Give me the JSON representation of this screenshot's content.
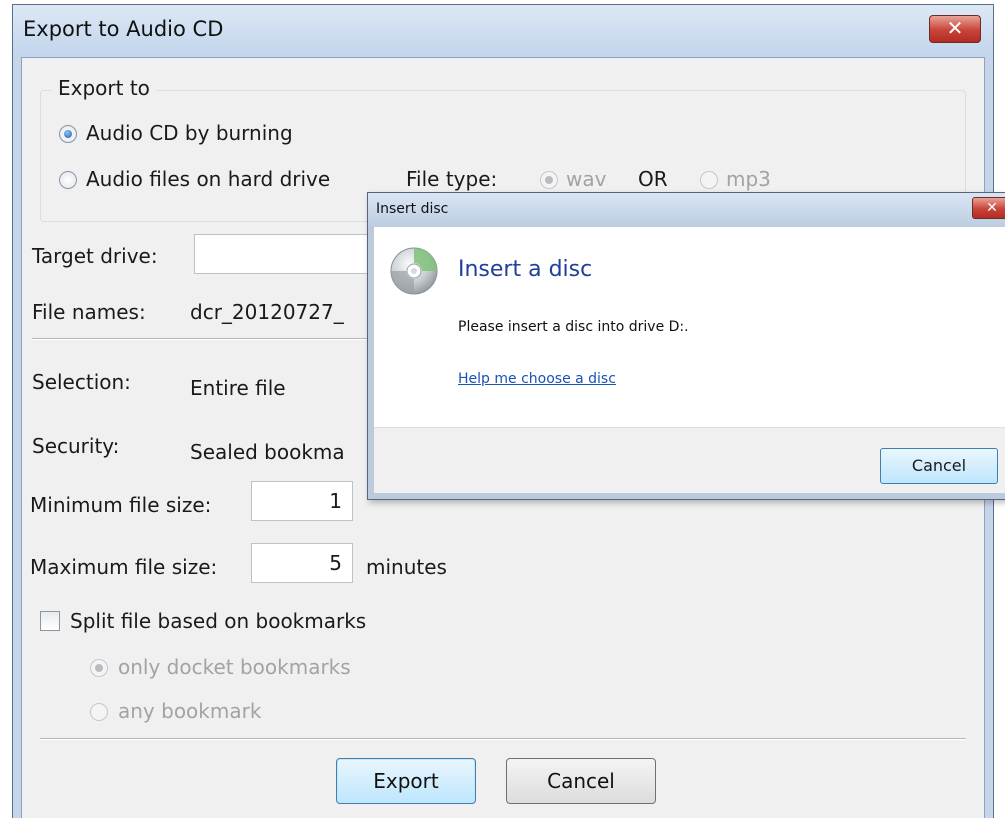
{
  "main_dialog": {
    "title": "Export to Audio CD",
    "close_glyph": "✕",
    "export_to": {
      "legend": "Export to",
      "option_burn": "Audio CD by burning",
      "option_files": "Audio files on hard drive",
      "file_type_label": "File type:",
      "type_wav": "wav",
      "or_label": "OR",
      "type_mp3": "mp3"
    },
    "target_drive_label": "Target drive:",
    "target_drive_value": "",
    "file_names_label": "File names:",
    "file_names_value": "dcr_20120727_",
    "selection_label": "Selection:",
    "selection_value": "Entire file",
    "security_label": "Security:",
    "security_value": "Sealed bookma",
    "min_size_label": "Minimum file size:",
    "min_size_value": "1",
    "max_size_label": "Maximum file size:",
    "max_size_value": "5",
    "max_size_unit": "minutes",
    "split_label": "Split file based on bookmarks",
    "split_checked": false,
    "split_option_docket": "only docket bookmarks",
    "split_option_any": "any bookmark",
    "export_button": "Export",
    "cancel_button": "Cancel"
  },
  "disc_dialog": {
    "title": "Insert disc",
    "close_glyph": "✕",
    "heading": "Insert a disc",
    "message": "Please insert a disc into drive D:.",
    "help_link": "Help me choose a disc",
    "cancel_button": "Cancel",
    "icon": "disc-icon"
  },
  "colors": {
    "title_bar": "#c5d6ea",
    "close_button": "#c8433a",
    "link": "#1a52b8",
    "heading": "#1f3f9a"
  }
}
